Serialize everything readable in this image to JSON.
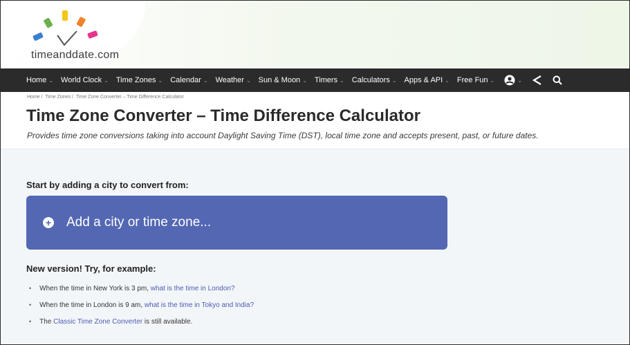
{
  "logo": {
    "text_main": "timeanddate.com"
  },
  "nav": {
    "items": [
      {
        "label": "Home",
        "chevron": "⌄"
      },
      {
        "label": "World Clock",
        "chevron": "⌄"
      },
      {
        "label": "Time Zones",
        "chevron": "⌄"
      },
      {
        "label": "Calendar",
        "chevron": "⌄"
      },
      {
        "label": "Weather",
        "chevron": "⌄"
      },
      {
        "label": "Sun & Moon",
        "chevron": "⌄"
      },
      {
        "label": "Timers",
        "chevron": "⌄"
      },
      {
        "label": "Calculators",
        "chevron": "⌄"
      },
      {
        "label": "Apps & API",
        "chevron": "⌄"
      },
      {
        "label": "Free Fun",
        "chevron": "⌄"
      }
    ],
    "icons": [
      "account-icon",
      "share-icon",
      "search-icon"
    ]
  },
  "breadcrumb": [
    "Home /",
    "Time Zones /",
    "Time Zone Converter – Time Difference Calculator"
  ],
  "page": {
    "title": "Time Zone Converter – Time Difference Calculator",
    "subtitle": "Provides time zone conversions taking into account Daylight Saving Time (DST), local time zone and accepts present, past, or future dates.",
    "start_label": "Start by adding a city to convert from:",
    "add_placeholder": "Add a city or time zone...",
    "new_version_label": "New version! Try, for example:",
    "examples": [
      {
        "prefix": "When the time in New York is 3 pm, ",
        "link": "what is the time in London?",
        "suffix": ""
      },
      {
        "prefix": "When the time in London is 9 am, ",
        "link": "what is the time in Tokyo and India?",
        "suffix": ""
      },
      {
        "prefix": "The ",
        "link": "Classic Time Zone Converter",
        "suffix": " is still available."
      }
    ]
  },
  "colors": {
    "nav_bg": "#2b2b2b",
    "add_box": "#5367b3",
    "link": "#4c5bb0"
  }
}
